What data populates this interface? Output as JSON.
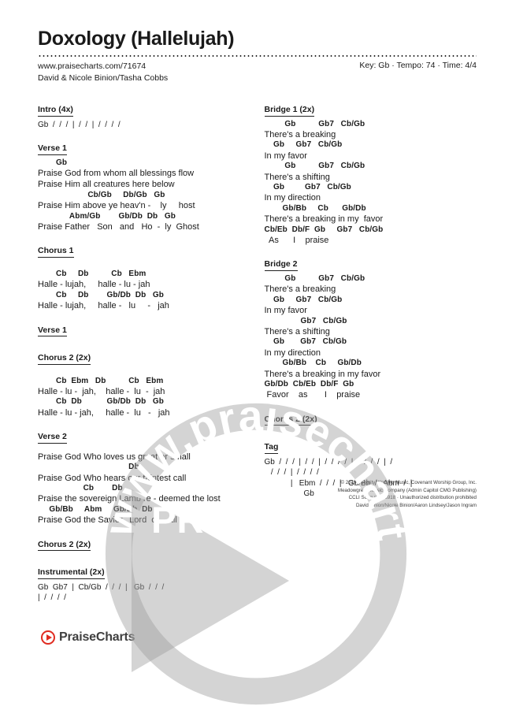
{
  "header": {
    "title": "Doxology (Hallelujah)",
    "url": "www.praisecharts.com/71674",
    "authors": "David & Nicole Binion/Tasha Cobbs",
    "key_tempo_time": "Key: Gb · Tempo: 74 · Time: 4/4"
  },
  "left_column": {
    "intro": {
      "heading": "Intro (4x)",
      "bars": "Gb  /  /  /  |  /  /  |  /  /  /  /"
    },
    "verse1": {
      "heading": "Verse 1",
      "lines": [
        {
          "chords": "        Gb",
          "lyric": "Praise God from whom all blessings flow"
        },
        {
          "chords": "",
          "lyric": "Praise Him all creatures here below"
        },
        {
          "chords": "                      Cb/Gb     Db/Gb   Gb",
          "lyric": "Praise Him above ye heav'n -    ly     host"
        },
        {
          "chords": "              Abm/Gb        Gb/Db  Db   Gb",
          "lyric": "Praise Father   Son   and   Ho  -  ly  Ghost"
        }
      ]
    },
    "chorus1": {
      "heading": "Chorus 1",
      "lines": [
        {
          "chords": "        Cb     Db          Cb   Ebm",
          "lyric": "Halle - lujah,     halle - lu - jah"
        },
        {
          "chords": "        Cb     Db        Gb/Db  Db   Gb",
          "lyric": "Halle - lujah,     halle -   lu     -   jah"
        }
      ]
    },
    "verse1_repeat": {
      "heading": "Verse 1"
    },
    "chorus2": {
      "heading": "Chorus 2 (2x)",
      "lines": [
        {
          "chords": "        Cb  Ebm   Db          Cb   Ebm",
          "lyric": "Halle - lu -  jah,    halle -  lu  -  jah"
        },
        {
          "chords": "        Cb  Db           Gb/Db  Db   Gb",
          "lyric": "Halle - lu - jah,     halle -  lu   -   jah"
        }
      ]
    },
    "verse2": {
      "heading": "Verse 2",
      "lines": [
        {
          "chords": "",
          "lyric": "Praise God Who loves us great or small"
        },
        {
          "chords": "                                        Db",
          "lyric": "Praise God Who hears our faintest call"
        },
        {
          "chords": "                    Cb        Db",
          "lyric": "Praise the sovereign Lamb re - deemed the lost"
        },
        {
          "chords": "     Gb/Bb     Abm     Gb/Db  Db",
          "lyric": "Praise God the Savior,  Lord  of    all"
        }
      ]
    },
    "chorus2_repeat": {
      "heading": "Chorus 2 (2x)"
    },
    "instrumental": {
      "heading": "Instrumental (2x)",
      "bars": [
        "Gb  Gb7  |  Cb/Gb  /  /  /  |   Gb  /  /  /",
        "|  /  /  /  /"
      ]
    }
  },
  "right_column": {
    "bridge1": {
      "heading": "Bridge 1 (2x)",
      "lines": [
        {
          "chords": "         Gb          Gb7   Cb/Gb",
          "lyric": "There's a breaking"
        },
        {
          "chords": "    Gb     Gb7   Cb/Gb",
          "lyric": "In my favor"
        },
        {
          "chords": "         Gb          Gb7   Cb/Gb",
          "lyric": "There's a shifting"
        },
        {
          "chords": "    Gb         Gb7   Cb/Gb",
          "lyric": "In my direction"
        },
        {
          "chords": "        Gb/Bb     Cb      Gb/Db",
          "lyric": "There's a breaking in my  favor"
        },
        {
          "chords": "Cb/Eb  Db/F  Gb     Gb7   Cb/Gb",
          "lyric": "  As      I    praise"
        }
      ]
    },
    "bridge2": {
      "heading": "Bridge 2",
      "lines": [
        {
          "chords": "         Gb          Gb7   Cb/Gb",
          "lyric": "There's a breaking"
        },
        {
          "chords": "    Gb     Gb7   Cb/Gb",
          "lyric": "In my favor"
        },
        {
          "chords": "                Gb7   Cb/Gb",
          "lyric": "There's a shifting"
        },
        {
          "chords": "    Gb       Gb7   Cb/Gb",
          "lyric": "In my direction"
        },
        {
          "chords": "        Gb/Bb    Cb     Gb/Db",
          "lyric": "There's a breaking in my favor"
        },
        {
          "chords": "Gb/Db  Cb/Eb  Db/F  Gb",
          "lyric": " Favor    as       I    praise"
        }
      ]
    },
    "chorus2_repeat": {
      "heading": "Chorus 2 (2x)"
    },
    "tag": {
      "heading": "Tag",
      "bars": [
        "Gb  /  /  /  |  /  /  |  /  /  /  /  |  /  /  /  /  |  /",
        "   /  /  /  |  /  /  /  /",
        "            |   Ebm  /  /  /  |   Gb/Bb  /   Abm  /  |",
        "                  Gb"
      ]
    }
  },
  "copyright": {
    "lines": [
      "© 2019 Integrity Worship Music, Covenant Worship Group, Inc.",
      "Meadowgreen Music Company (Admin Capitol CMG Publishing)",
      "CCLI Song #7138918 · Unauthorized distribution prohibited",
      "David Binion/Nicole Binion/Aaron Lindsey/Jason Ingram"
    ]
  },
  "watermark": {
    "arc_text": "www.praisecharts.com",
    "preview_label": "PREVIEW"
  },
  "footer": {
    "logo_text": "PraiseCharts",
    "logo_color": "#e02b20"
  }
}
